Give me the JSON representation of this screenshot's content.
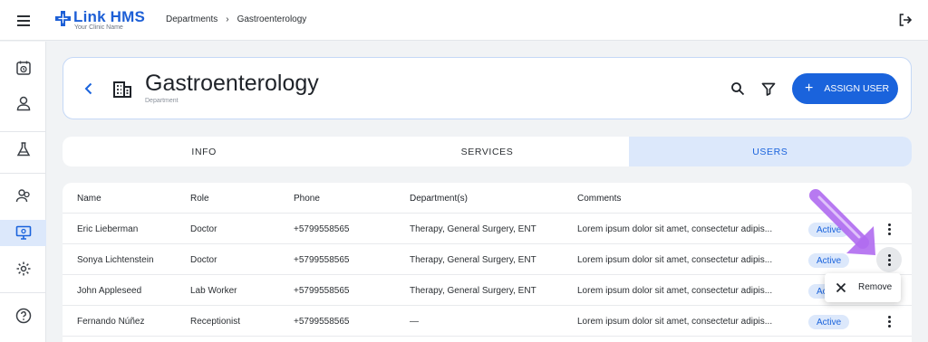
{
  "app": {
    "name": "Link HMS",
    "tagline": "Your Clinic Name",
    "brand_color": "#1a63dc"
  },
  "breadcrumb": [
    "Departments",
    "Gastroenterology"
  ],
  "breadcrumb_separator": "›",
  "sidebar": {
    "items": [
      {
        "icon": "calendar-icon",
        "active": false
      },
      {
        "icon": "user-icon",
        "active": false
      },
      {
        "icon": "flask-icon",
        "active": false
      },
      {
        "icon": "users-icon",
        "active": false
      },
      {
        "icon": "monitor-icon",
        "active": true
      },
      {
        "icon": "gear-icon",
        "active": false
      },
      {
        "icon": "help-icon",
        "active": false
      }
    ]
  },
  "header": {
    "title": "Gastroenterology",
    "subtitle": "Department",
    "assign_label": "ASSIGN USER"
  },
  "tabs": [
    {
      "label": "INFO",
      "active": false
    },
    {
      "label": "SERVICES",
      "active": false
    },
    {
      "label": "USERS",
      "active": true
    }
  ],
  "table": {
    "columns": [
      "Name",
      "Role",
      "Phone",
      "Department(s)",
      "Comments"
    ],
    "rows": [
      {
        "name": "Eric Lieberman",
        "role": "Doctor",
        "phone": "+5799558565",
        "departments": "Therapy, General Surgery, ENT",
        "comments": "Lorem ipsum dolor sit amet, consectetur adipis...",
        "status": "Active"
      },
      {
        "name": "Sonya Lichtenstein",
        "role": "Doctor",
        "phone": "+5799558565",
        "departments": "Therapy, General Surgery, ENT",
        "comments": "Lorem ipsum dolor sit amet, consectetur adipis...",
        "status": "Active"
      },
      {
        "name": "John Appleseed",
        "role": "Lab Worker",
        "phone": "+5799558565",
        "departments": "Therapy, General Surgery, ENT",
        "comments": "Lorem ipsum dolor sit amet, consectetur adipis...",
        "status": "Active"
      },
      {
        "name": "Fernando Núñez",
        "role": "Receptionist",
        "phone": "+5799558565",
        "departments": "—",
        "comments": "Lorem ipsum dolor sit amet, consectetur adipis...",
        "status": "Active"
      }
    ]
  },
  "context_menu": {
    "items": [
      {
        "label": "Remove",
        "icon": "close-icon"
      }
    ]
  },
  "pointer_color": "#b06bf0"
}
